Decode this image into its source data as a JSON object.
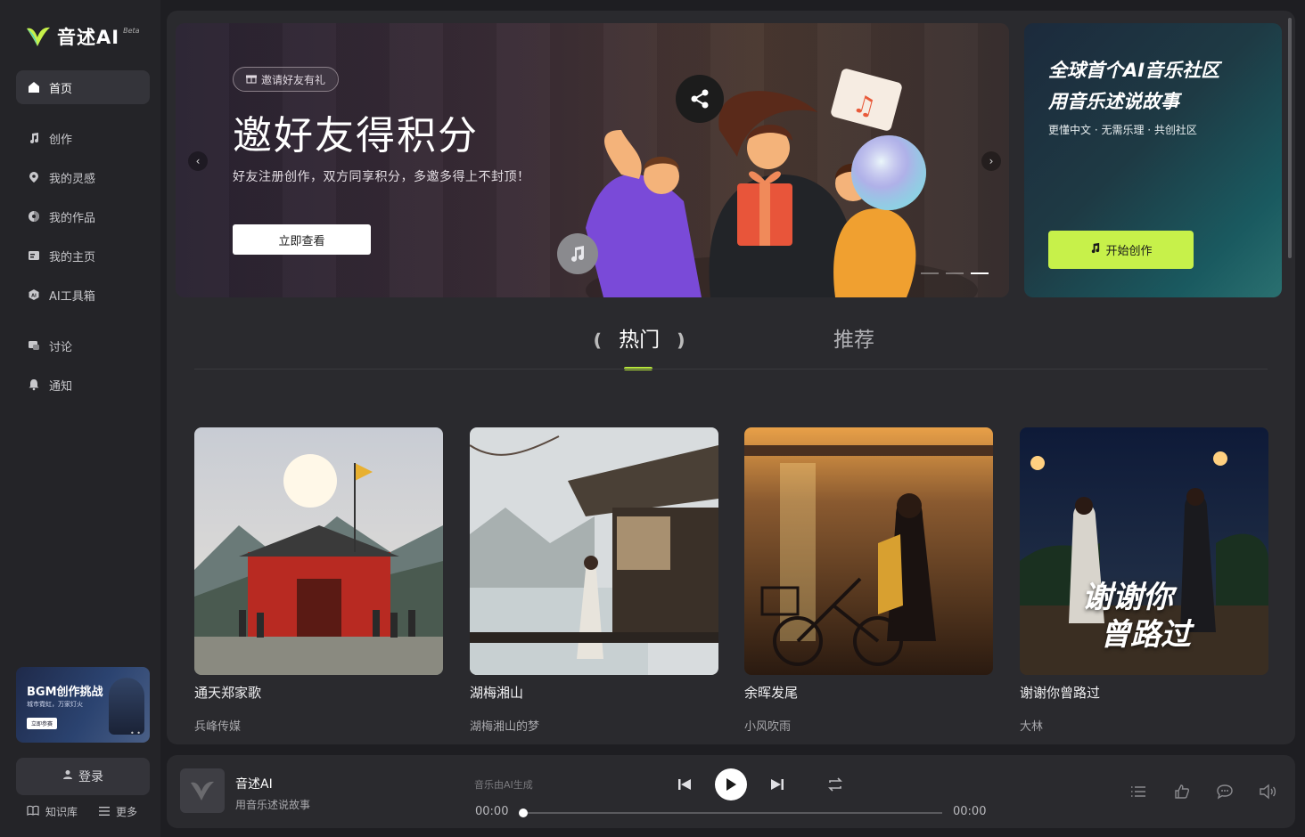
{
  "brand": {
    "name": "音述AI",
    "badge": "Beta"
  },
  "nav": [
    {
      "label": "首页",
      "icon": "home-icon",
      "active": true
    },
    {
      "label": "创作",
      "icon": "music-note-icon"
    },
    {
      "label": "我的灵感",
      "icon": "location-pin-icon"
    },
    {
      "label": "我的作品",
      "icon": "disc-icon"
    },
    {
      "label": "我的主页",
      "icon": "profile-card-icon"
    },
    {
      "label": "AI工具箱",
      "icon": "ai-hexagon-icon"
    },
    {
      "label": "讨论",
      "icon": "discussion-icon"
    },
    {
      "label": "通知",
      "icon": "bell-icon"
    }
  ],
  "promo": {
    "title": "BGM创作挑战",
    "subtitle": "城市霓虹，万家灯火",
    "button": "立即参赛"
  },
  "login": "登录",
  "footer": {
    "knowledge": "知识库",
    "more": "更多"
  },
  "banner": {
    "pill": "邀请好友有礼",
    "title": "邀好友得积分",
    "subtitle": "好友注册创作，双方同享积分，多邀多得上不封顶！",
    "button": "立即查看",
    "slides": 3,
    "active_slide": 3
  },
  "side_banner": {
    "line1": "全球首个AI音乐社区",
    "line2": "用音乐述说故事",
    "subtitle": "更懂中文 · 无需乐理 · 共创社区",
    "button": "开始创作",
    "accent": "#c7f14a"
  },
  "tabs": {
    "hot": "热门",
    "recommend": "推荐",
    "active": "hot"
  },
  "songs": [
    {
      "title": "通天郑家歌",
      "author": "兵峰传媒"
    },
    {
      "title": "湖梅湘山",
      "author": "湖梅湘山的梦"
    },
    {
      "title": "余晖发尾",
      "author": "小风吹雨"
    },
    {
      "title": "谢谢你曾路过",
      "author": "大林",
      "cover_text_1": "谢谢你",
      "cover_text_2": "曾路过"
    }
  ],
  "player": {
    "title": "音述AI",
    "subtitle": "用音乐述说故事",
    "generated": "音乐由AI生成",
    "current_time": "00:00",
    "total_time": "00:00",
    "progress": 0
  }
}
